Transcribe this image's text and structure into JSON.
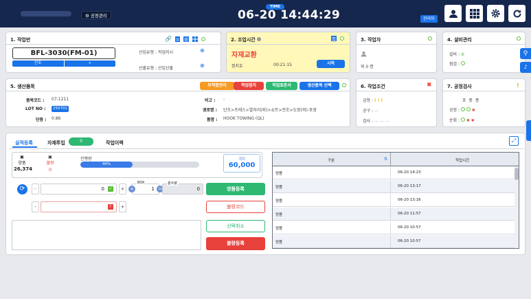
{
  "header": {
    "menu_label": "공정관리",
    "time_badge": "TIME",
    "clock": "06-20 14:44:29",
    "role": "관리자",
    "buttons": [
      "user-icon",
      "grid-icon",
      "gear-icon",
      "refresh-icon"
    ]
  },
  "workshift": {
    "title": "1. 작업반",
    "work_order": "BFL-3030(FM-01)",
    "tab_single": "단조",
    "tab_plus": "+",
    "input_type_label": "산입유형 :",
    "input_type_value": "작업지시",
    "output_type_label": "산출유형 :",
    "output_type_value": "산입산출"
  },
  "optime": {
    "title": "2. 조업시간",
    "status": "자재교환",
    "stop_label": "정지호",
    "elapsed": "00:21:15",
    "start_btn": "시작"
  },
  "worker": {
    "title": "3. 작업자",
    "count": "외 0 명"
  },
  "equipment": {
    "title": "4. 설비관리",
    "facility_label": "설비 :",
    "check_label": "점검 :"
  },
  "product": {
    "title": "5. 생산품목",
    "btn_defect": "부적합관리",
    "btn_stop": "작업정지",
    "btn_standard": "작업표준서",
    "btn_select": "생산품목 선택",
    "code_label": "품목코드 :",
    "code_value": "07-1211",
    "lot_label": "LOT NO :",
    "lot_value": "250701",
    "weight_label": "단중 :",
    "weight_value": "0.86",
    "note_label": "비고 :",
    "note_value": "-",
    "route_label": "경로명 :",
    "route_value": "단조>프레스>열처리(외)>쇼트>전조>도장(외)-포장",
    "name_label": "품명 :",
    "name_value": "HOOK TOWING (QL)"
  },
  "condition": {
    "title": "6. 작업조건",
    "mold_label": "금형 :",
    "tool_label": "공구 :",
    "inspect_label": "검사 :"
  },
  "inspection": {
    "title": "7. 공정검사",
    "cols": "초 중 종",
    "process_label": "공정 :",
    "patrol_label": "순회 :"
  },
  "tabs": {
    "result": "실적등록",
    "material": "자재투입",
    "material_count": "0",
    "history": "작업이력"
  },
  "result": {
    "good_label": "양품",
    "good_value": "26,374",
    "bad_label": "불량",
    "bad_value": "0",
    "progress_label": "진행량",
    "progress_percent": 44,
    "progress_text": "44%",
    "plan_label": "계획",
    "plan_value": "60,000",
    "qty_value": "0",
    "box_label": "BOX",
    "box_value": "1",
    "total_label": "총수량",
    "total_value": "0",
    "btn_good": "양품등록",
    "btn_badcode": "불량코드",
    "btn_cancel": "선택취소",
    "btn_bad": "불량등록",
    "minus": "-",
    "plus": "+"
  },
  "history_grid": {
    "col_type": "구분",
    "col_time": "작업시간",
    "rows": [
      {
        "type": "양품",
        "time": "06-20 14:23"
      },
      {
        "type": "양품",
        "time": "06-20 13:17"
      },
      {
        "type": "양품",
        "time": "06-20 13:16"
      },
      {
        "type": "양품",
        "time": "06-20 11:57"
      },
      {
        "type": "양품",
        "time": "06-20 10:57"
      },
      {
        "type": "양품",
        "time": "06-20 10:57"
      }
    ]
  },
  "colors": {
    "navy": "#16274d",
    "blue": "#1a73e8",
    "orange": "#f59a24",
    "red": "#e8413b",
    "green": "#2eb872",
    "yellow_panel": "#fff8b8"
  }
}
